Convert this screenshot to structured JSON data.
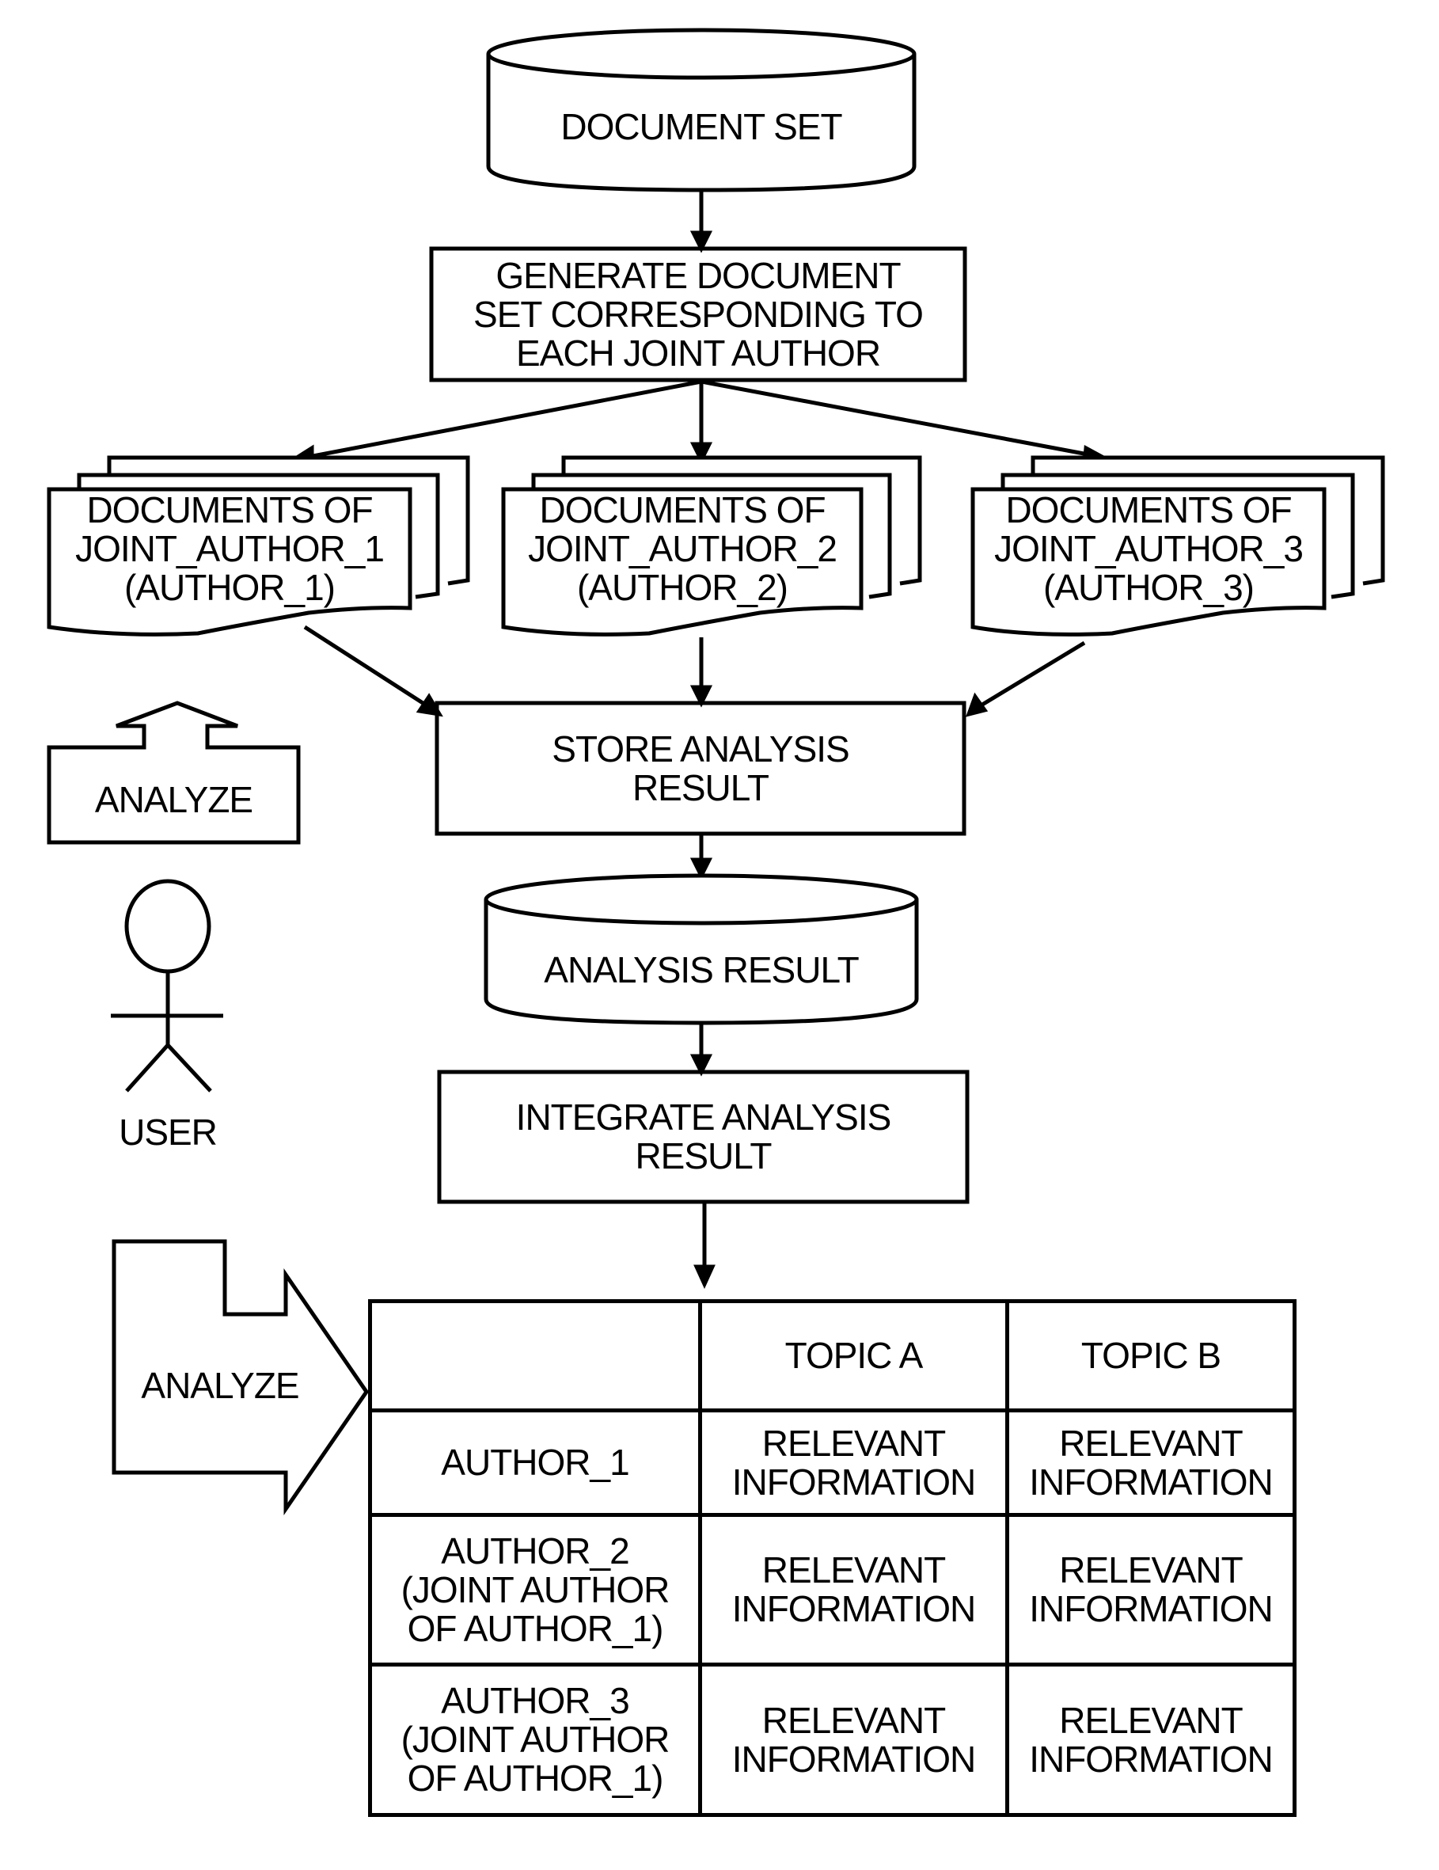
{
  "nodes": {
    "document_set": "DOCUMENT SET",
    "generate": "GENERATE DOCUMENT\nSET CORRESPONDING TO\nEACH JOINT AUTHOR",
    "docs": [
      "DOCUMENTS OF\nJOINT_AUTHOR_1\n(AUTHOR_1)",
      "DOCUMENTS OF\nJOINT_AUTHOR_2\n(AUTHOR_2)",
      "DOCUMENTS OF\nJOINT_AUTHOR_3\n(AUTHOR_3)"
    ],
    "store": "STORE ANALYSIS\nRESULT",
    "analysis_result": "ANALYSIS RESULT",
    "integrate": "INTEGRATE ANALYSIS\nRESULT"
  },
  "side": {
    "analyze_top": "ANALYZE",
    "user": "USER",
    "analyze_bottom": "ANALYZE"
  },
  "table": {
    "headers": [
      "",
      "TOPIC A",
      "TOPIC B"
    ],
    "rows": [
      [
        "AUTHOR_1",
        "RELEVANT\nINFORMATION",
        "RELEVANT\nINFORMATION"
      ],
      [
        "AUTHOR_2\n(JOINT AUTHOR\nOF AUTHOR_1)",
        "RELEVANT\nINFORMATION",
        "RELEVANT\nINFORMATION"
      ],
      [
        "AUTHOR_3\n(JOINT AUTHOR\nOF AUTHOR_1)",
        "RELEVANT\nINFORMATION",
        "RELEVANT\nINFORMATION"
      ]
    ]
  }
}
